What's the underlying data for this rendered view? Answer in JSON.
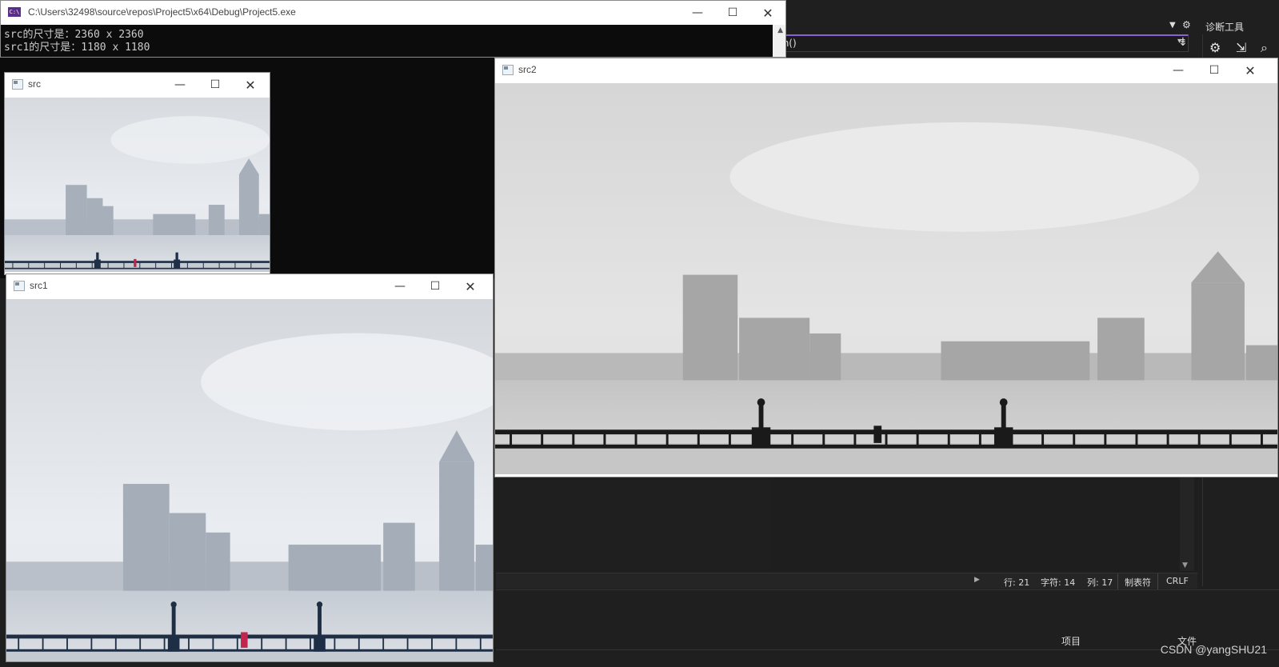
{
  "console_window": {
    "title": "C:\\Users\\32498\\source\\repos\\Project5\\x64\\Debug\\Project5.exe",
    "icon": "console-app-icon",
    "lines": [
      "src的尺寸是：2360 x 2360",
      "src1的尺寸是：1180 x 1180"
    ]
  },
  "windows": {
    "src": {
      "title": "src"
    },
    "src1": {
      "title": "src1"
    },
    "src2": {
      "title": "src2"
    }
  },
  "window_buttons": {
    "minimize": "—",
    "maximize": "☐",
    "close": "✕"
  },
  "vs": {
    "diag_tools_label": "诊断工具",
    "nav_function": "ain()",
    "status": {
      "line": "行: 21",
      "char": "字符: 14",
      "col": "列: 17",
      "tabs": "制表符",
      "eol": "CRLF"
    },
    "bottom": {
      "project_label": "项目",
      "file_label": "文件"
    }
  },
  "watermark": "CSDN @yangSHU21",
  "colors": {
    "vs_background": "#1f1f1f",
    "vs_accent": "#8a63d2",
    "console_background": "#0c0c0c",
    "console_text": "#cccccc"
  }
}
